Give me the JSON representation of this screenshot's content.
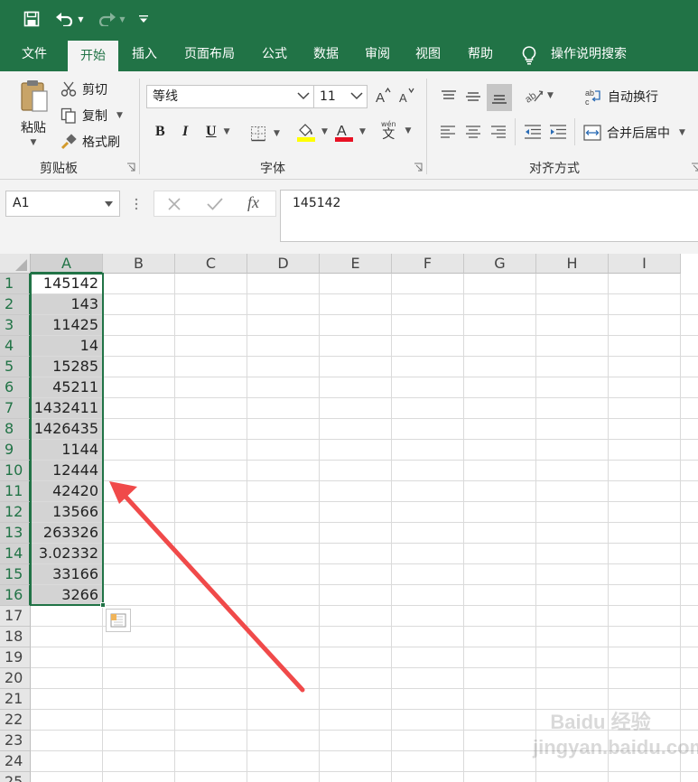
{
  "colors": {
    "brand_green": "#217346",
    "ribbon_bg": "#f3f3f3",
    "selection": "#d3d3d3",
    "annotation_arrow": "#f04a4a"
  },
  "quick_access": {
    "icons": [
      "save-icon",
      "undo-icon",
      "redo-icon",
      "customize-icon"
    ]
  },
  "tabs": [
    "文件",
    "开始",
    "插入",
    "页面布局",
    "公式",
    "数据",
    "审阅",
    "视图",
    "帮助"
  ],
  "active_tab": "开始",
  "tell_me": "操作说明搜索",
  "clipboard": {
    "paste": "粘贴",
    "cut": "剪切",
    "copy": "复制",
    "format_painter": "格式刷",
    "group_label": "剪贴板"
  },
  "font": {
    "name": "等线",
    "size": "11",
    "group_label": "字体",
    "bold": "B",
    "italic": "I",
    "underline": "U",
    "font_color_letter": "A",
    "phonetic": "wén",
    "phonetic_char": "文"
  },
  "alignment": {
    "wrap_text": "自动换行",
    "merge_center": "合并后居中",
    "group_label": "对齐方式"
  },
  "formula_bar": {
    "name_box": "A1",
    "fx": "fx",
    "value": "145142"
  },
  "columns": [
    "A",
    "B",
    "C",
    "D",
    "E",
    "F",
    "G",
    "H",
    "I"
  ],
  "rows": [
    "1",
    "2",
    "3",
    "4",
    "5",
    "6",
    "7",
    "8",
    "9",
    "10",
    "11",
    "12",
    "13",
    "14",
    "15",
    "16",
    "17",
    "18",
    "19",
    "20",
    "21",
    "22",
    "23",
    "24",
    "25"
  ],
  "column_a_values": [
    "145142",
    "143",
    "11425",
    "14",
    "15285",
    "45211",
    "1432411",
    "1426435",
    "1144",
    "12444",
    "42420",
    "13566",
    "263326",
    "3.02332",
    "33166",
    "3266"
  ],
  "watermark": "Baidu 经验 jingyan.baidu.com"
}
